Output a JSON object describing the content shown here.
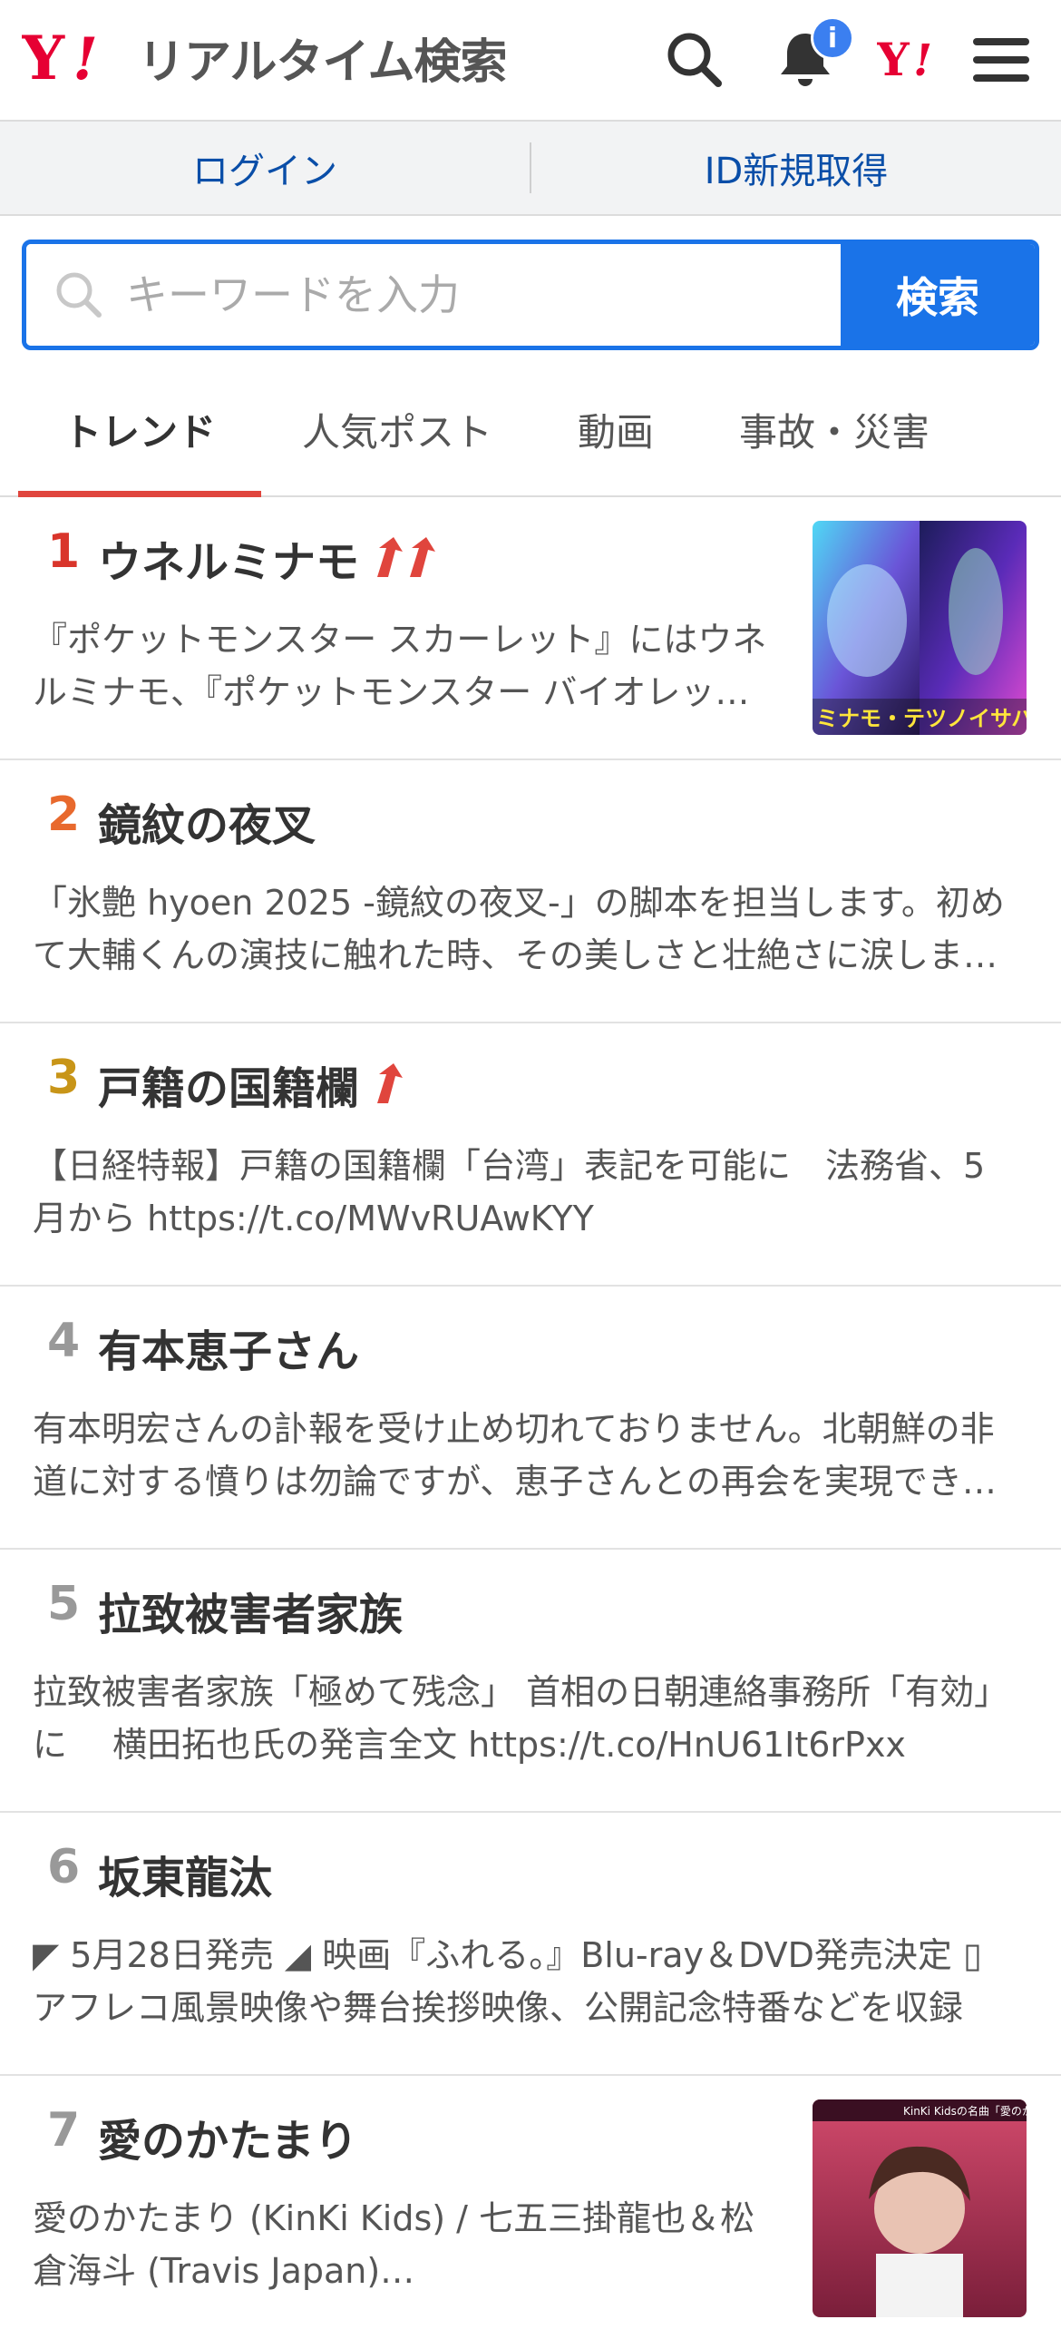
{
  "header": {
    "logo_text": "リアルタイム検索",
    "notification_count": "i",
    "icons": [
      "search-icon",
      "bell-icon",
      "yahoo-logo-icon",
      "hamburger-menu-icon"
    ]
  },
  "login": {
    "login_label": "ログイン",
    "signup_label": "ID新規取得"
  },
  "search": {
    "placeholder": "キーワードを入力",
    "button_label": "検索"
  },
  "tabs": [
    {
      "label": "トレンド",
      "active": true
    },
    {
      "label": "人気ポスト",
      "active": false
    },
    {
      "label": "動画",
      "active": false
    },
    {
      "label": "事故・災害",
      "active": false
    }
  ],
  "colors": {
    "accent_blue": "#1a73e8",
    "link_blue": "#0a4ea8",
    "tab_underline": "#e0453d",
    "rank1": "#d9352b",
    "rank2": "#e8692d",
    "rank3": "#c89518",
    "rank_other": "#999999",
    "arrow_red": "#e0453d"
  },
  "trends": [
    {
      "rank": "1",
      "title": "ウネルミナモ",
      "arrows": 2,
      "desc": "『ポケットモンスター スカーレット』にはウネルミナモ、『ポケットモンスター バイオレット』にはテツノイサハ",
      "thumb": "ミナモ・テツノイサハ"
    },
    {
      "rank": "2",
      "title": "鏡紋の夜叉",
      "arrows": 0,
      "desc": "「氷艶 hyoen 2025 -鏡紋の夜叉-」の脚本を担当します。初めて大輔くんの演技に触れた時、その美しさと壮絶さに涙しました"
    },
    {
      "rank": "3",
      "title": "戸籍の国籍欄",
      "arrows": 1,
      "desc": "【日経特報】戸籍の国籍欄「台湾」表記を可能に　法務省、5月から https://t.co/MWvRUAwKYY"
    },
    {
      "rank": "4",
      "title": "有本恵子さん",
      "arrows": 0,
      "desc": "有本明宏さんの訃報を受け止め切れておりません。北朝鮮の非道に対する憤りは勿論ですが、恵子さんとの再会を実現できなかった"
    },
    {
      "rank": "5",
      "title": "拉致被害者家族",
      "arrows": 0,
      "desc": "拉致被害者家族「極めて残念」 首相の日朝連絡事務所「有効」に　 横田拓也氏の発言全文 https://t.co/HnU61It6rPxx"
    },
    {
      "rank": "6",
      "title": "坂東龍汰",
      "arrows": 0,
      "desc": "◤ 5月28日発売 ◢ 映画『ふれる。』Blu-ray＆DVD発売決定 ▯アフレコ風景映像や舞台挨拶映像、公開記念特番などを収録"
    },
    {
      "rank": "7",
      "title": "愛のかたまり",
      "arrows": 0,
      "desc": "愛のかたまり (KinKi Kids) / 七五三掛龍也＆松倉海斗 (Travis Japan)…",
      "thumb": "KinKi Kidsの名曲「愛のかたまり」"
    }
  ]
}
